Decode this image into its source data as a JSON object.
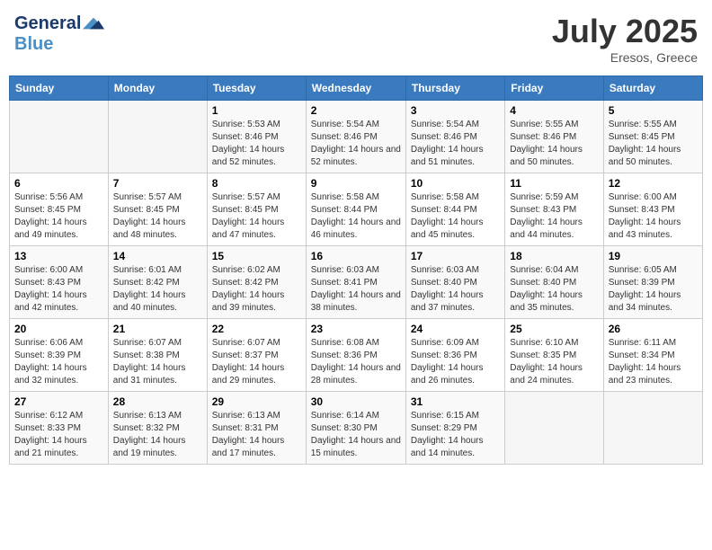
{
  "header": {
    "logo_line1": "General",
    "logo_line2": "Blue",
    "month_title": "July 2025",
    "location": "Eresos, Greece"
  },
  "days_of_week": [
    "Sunday",
    "Monday",
    "Tuesday",
    "Wednesday",
    "Thursday",
    "Friday",
    "Saturday"
  ],
  "weeks": [
    [
      {
        "day": "",
        "sunrise": "",
        "sunset": "",
        "daylight": ""
      },
      {
        "day": "",
        "sunrise": "",
        "sunset": "",
        "daylight": ""
      },
      {
        "day": "1",
        "sunrise": "Sunrise: 5:53 AM",
        "sunset": "Sunset: 8:46 PM",
        "daylight": "Daylight: 14 hours and 52 minutes."
      },
      {
        "day": "2",
        "sunrise": "Sunrise: 5:54 AM",
        "sunset": "Sunset: 8:46 PM",
        "daylight": "Daylight: 14 hours and 52 minutes."
      },
      {
        "day": "3",
        "sunrise": "Sunrise: 5:54 AM",
        "sunset": "Sunset: 8:46 PM",
        "daylight": "Daylight: 14 hours and 51 minutes."
      },
      {
        "day": "4",
        "sunrise": "Sunrise: 5:55 AM",
        "sunset": "Sunset: 8:46 PM",
        "daylight": "Daylight: 14 hours and 50 minutes."
      },
      {
        "day": "5",
        "sunrise": "Sunrise: 5:55 AM",
        "sunset": "Sunset: 8:45 PM",
        "daylight": "Daylight: 14 hours and 50 minutes."
      }
    ],
    [
      {
        "day": "6",
        "sunrise": "Sunrise: 5:56 AM",
        "sunset": "Sunset: 8:45 PM",
        "daylight": "Daylight: 14 hours and 49 minutes."
      },
      {
        "day": "7",
        "sunrise": "Sunrise: 5:57 AM",
        "sunset": "Sunset: 8:45 PM",
        "daylight": "Daylight: 14 hours and 48 minutes."
      },
      {
        "day": "8",
        "sunrise": "Sunrise: 5:57 AM",
        "sunset": "Sunset: 8:45 PM",
        "daylight": "Daylight: 14 hours and 47 minutes."
      },
      {
        "day": "9",
        "sunrise": "Sunrise: 5:58 AM",
        "sunset": "Sunset: 8:44 PM",
        "daylight": "Daylight: 14 hours and 46 minutes."
      },
      {
        "day": "10",
        "sunrise": "Sunrise: 5:58 AM",
        "sunset": "Sunset: 8:44 PM",
        "daylight": "Daylight: 14 hours and 45 minutes."
      },
      {
        "day": "11",
        "sunrise": "Sunrise: 5:59 AM",
        "sunset": "Sunset: 8:43 PM",
        "daylight": "Daylight: 14 hours and 44 minutes."
      },
      {
        "day": "12",
        "sunrise": "Sunrise: 6:00 AM",
        "sunset": "Sunset: 8:43 PM",
        "daylight": "Daylight: 14 hours and 43 minutes."
      }
    ],
    [
      {
        "day": "13",
        "sunrise": "Sunrise: 6:00 AM",
        "sunset": "Sunset: 8:43 PM",
        "daylight": "Daylight: 14 hours and 42 minutes."
      },
      {
        "day": "14",
        "sunrise": "Sunrise: 6:01 AM",
        "sunset": "Sunset: 8:42 PM",
        "daylight": "Daylight: 14 hours and 40 minutes."
      },
      {
        "day": "15",
        "sunrise": "Sunrise: 6:02 AM",
        "sunset": "Sunset: 8:42 PM",
        "daylight": "Daylight: 14 hours and 39 minutes."
      },
      {
        "day": "16",
        "sunrise": "Sunrise: 6:03 AM",
        "sunset": "Sunset: 8:41 PM",
        "daylight": "Daylight: 14 hours and 38 minutes."
      },
      {
        "day": "17",
        "sunrise": "Sunrise: 6:03 AM",
        "sunset": "Sunset: 8:40 PM",
        "daylight": "Daylight: 14 hours and 37 minutes."
      },
      {
        "day": "18",
        "sunrise": "Sunrise: 6:04 AM",
        "sunset": "Sunset: 8:40 PM",
        "daylight": "Daylight: 14 hours and 35 minutes."
      },
      {
        "day": "19",
        "sunrise": "Sunrise: 6:05 AM",
        "sunset": "Sunset: 8:39 PM",
        "daylight": "Daylight: 14 hours and 34 minutes."
      }
    ],
    [
      {
        "day": "20",
        "sunrise": "Sunrise: 6:06 AM",
        "sunset": "Sunset: 8:39 PM",
        "daylight": "Daylight: 14 hours and 32 minutes."
      },
      {
        "day": "21",
        "sunrise": "Sunrise: 6:07 AM",
        "sunset": "Sunset: 8:38 PM",
        "daylight": "Daylight: 14 hours and 31 minutes."
      },
      {
        "day": "22",
        "sunrise": "Sunrise: 6:07 AM",
        "sunset": "Sunset: 8:37 PM",
        "daylight": "Daylight: 14 hours and 29 minutes."
      },
      {
        "day": "23",
        "sunrise": "Sunrise: 6:08 AM",
        "sunset": "Sunset: 8:36 PM",
        "daylight": "Daylight: 14 hours and 28 minutes."
      },
      {
        "day": "24",
        "sunrise": "Sunrise: 6:09 AM",
        "sunset": "Sunset: 8:36 PM",
        "daylight": "Daylight: 14 hours and 26 minutes."
      },
      {
        "day": "25",
        "sunrise": "Sunrise: 6:10 AM",
        "sunset": "Sunset: 8:35 PM",
        "daylight": "Daylight: 14 hours and 24 minutes."
      },
      {
        "day": "26",
        "sunrise": "Sunrise: 6:11 AM",
        "sunset": "Sunset: 8:34 PM",
        "daylight": "Daylight: 14 hours and 23 minutes."
      }
    ],
    [
      {
        "day": "27",
        "sunrise": "Sunrise: 6:12 AM",
        "sunset": "Sunset: 8:33 PM",
        "daylight": "Daylight: 14 hours and 21 minutes."
      },
      {
        "day": "28",
        "sunrise": "Sunrise: 6:13 AM",
        "sunset": "Sunset: 8:32 PM",
        "daylight": "Daylight: 14 hours and 19 minutes."
      },
      {
        "day": "29",
        "sunrise": "Sunrise: 6:13 AM",
        "sunset": "Sunset: 8:31 PM",
        "daylight": "Daylight: 14 hours and 17 minutes."
      },
      {
        "day": "30",
        "sunrise": "Sunrise: 6:14 AM",
        "sunset": "Sunset: 8:30 PM",
        "daylight": "Daylight: 14 hours and 15 minutes."
      },
      {
        "day": "31",
        "sunrise": "Sunrise: 6:15 AM",
        "sunset": "Sunset: 8:29 PM",
        "daylight": "Daylight: 14 hours and 14 minutes."
      },
      {
        "day": "",
        "sunrise": "",
        "sunset": "",
        "daylight": ""
      },
      {
        "day": "",
        "sunrise": "",
        "sunset": "",
        "daylight": ""
      }
    ]
  ]
}
